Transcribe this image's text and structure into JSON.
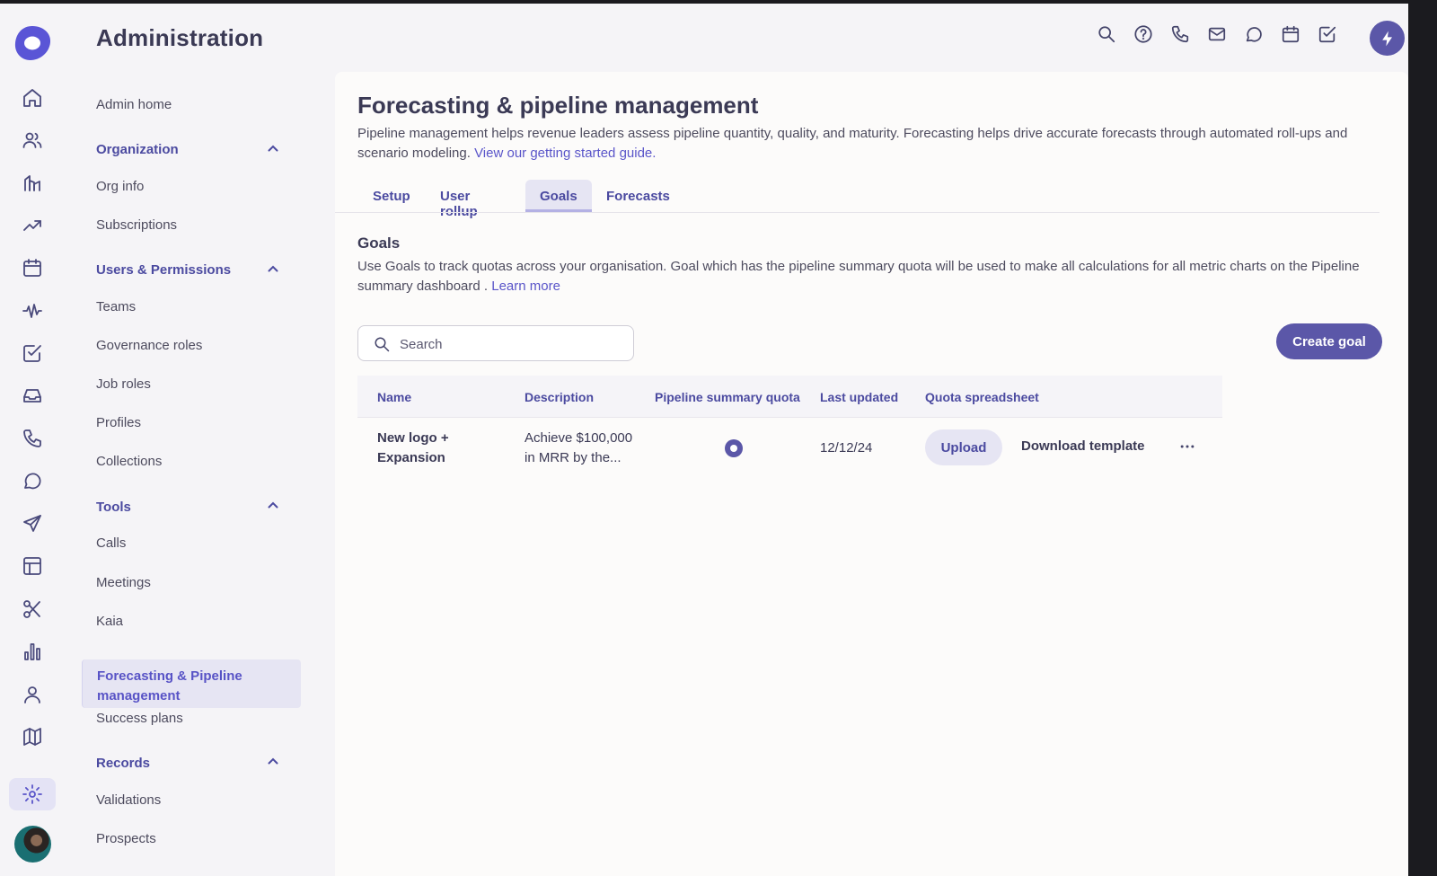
{
  "app": {
    "title": "Administration"
  },
  "rail": {
    "icons": [
      "home-icon",
      "people-icon",
      "accounts-icon",
      "trending-icon",
      "calendar-icon",
      "activity-icon",
      "tasks-icon",
      "inbox-icon",
      "phone-icon",
      "chat-icon",
      "send-icon",
      "layout-icon",
      "scissors-icon",
      "chart-icon",
      "person-icon",
      "map-icon",
      "settings-icon"
    ]
  },
  "header": {
    "icons": [
      "search-icon",
      "help-icon",
      "phone-icon",
      "mail-icon",
      "chat-icon",
      "calendar-icon",
      "task-icon",
      "bolt-icon"
    ]
  },
  "nav": {
    "admin_home": "Admin home",
    "sections": [
      {
        "label": "Organization",
        "items": [
          "Org info",
          "Subscriptions"
        ]
      },
      {
        "label": "Users & Permissions",
        "items": [
          "Teams",
          "Governance roles",
          "Job roles",
          "Profiles",
          "Collections"
        ]
      },
      {
        "label": "Tools",
        "items": [
          "Calls",
          "Meetings",
          "Kaia",
          "Forecasting & Pipeline management",
          "Success plans"
        ]
      },
      {
        "label": "Records",
        "items": [
          "Validations",
          "Prospects"
        ]
      }
    ],
    "active_item": "Forecasting & Pipeline management"
  },
  "page": {
    "title": "Forecasting & pipeline management",
    "intro": "Pipeline management helps revenue leaders assess pipeline quantity, quality, and maturity. Forecasting helps drive accurate forecasts through automated roll-ups and scenario modeling. ",
    "intro_link": "View our getting started guide.",
    "tabs": [
      "Setup",
      "User rollup",
      "Goals",
      "Forecasts"
    ],
    "active_tab": "Goals"
  },
  "goals": {
    "heading": "Goals",
    "description": "Use Goals to track quotas across your organisation. Goal which has the pipeline summary quota  will be used to make all calculations for all metric charts on the Pipeline summary dashboard . ",
    "learn_more": "Learn more",
    "search_placeholder": "Search",
    "create_label": "Create goal",
    "columns": [
      "Name",
      "Description",
      "Pipeline summary quota",
      "Last updated",
      "Quota spreadsheet"
    ],
    "rows": [
      {
        "name_line1": "New logo +",
        "name_line2": "Expansion",
        "desc_line1": "Achieve $100,000",
        "desc_line2": "in MRR by the...",
        "pipeline_quota_selected": true,
        "last_updated": "12/12/24",
        "upload_label": "Upload",
        "download_label": "Download template",
        "more_label": "···"
      }
    ]
  },
  "colors": {
    "accent": "#5b57a8",
    "link": "#5a55c9",
    "nav_section": "#4b4aa0"
  }
}
